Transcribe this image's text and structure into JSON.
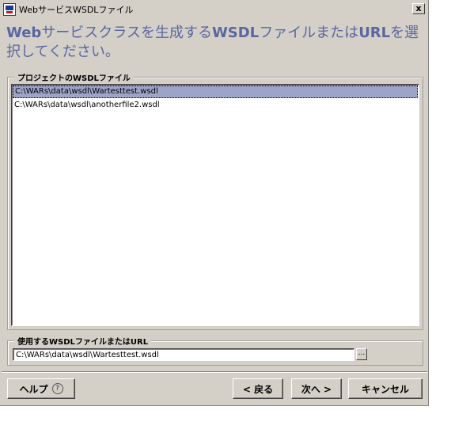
{
  "window": {
    "title": "WebサービスWSDLファイル",
    "close_label": "x"
  },
  "heading": {
    "part1": "Web",
    "part2": "サービスクラスを生成する",
    "part3": "WSDL",
    "part4": "ファイルまたは",
    "part5": "URL",
    "part6": "を選択してください。"
  },
  "project_group": {
    "label": "プロジェクトのWSDLファイル",
    "items": [
      {
        "label": "C:\\WARs\\data\\wsdl\\Wartesttest.wsdl",
        "selected": true
      },
      {
        "label": "C:\\WARs\\data\\wsdl\\anotherfile2.wsdl",
        "selected": false
      }
    ]
  },
  "url_group": {
    "label": "使用するWSDLファイルまたはURL",
    "value": "C:\\WARs\\data\\wsdl\\Wartesttest.wsdl",
    "browse_label": "..."
  },
  "buttons": {
    "help": "ヘルプ",
    "help_icon": "?",
    "back": "< 戻る",
    "next": "次へ >",
    "cancel": "キャンセル"
  },
  "colors": {
    "dialog_bg": "#d4d0c8",
    "heading_text": "#5a66a0",
    "selection_bg": "#9ea3c8"
  }
}
